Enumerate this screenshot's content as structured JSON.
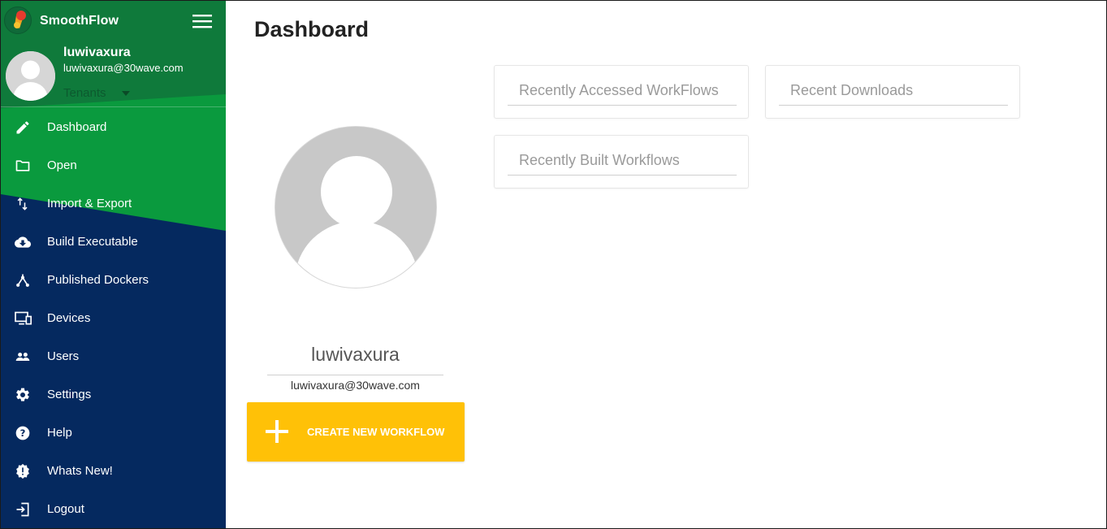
{
  "app": {
    "name": "SmoothFlow"
  },
  "user": {
    "name": "luwivaxura",
    "email": "luwivaxura@30wave.com",
    "tenants_label": "Tenants"
  },
  "nav": {
    "items": [
      {
        "label": "Dashboard",
        "icon": "pencil-icon"
      },
      {
        "label": "Open",
        "icon": "folder-icon"
      },
      {
        "label": "Import & Export",
        "icon": "import-export-icon"
      },
      {
        "label": "Build Executable",
        "icon": "cloud-download-icon"
      },
      {
        "label": "Published Dockers",
        "icon": "fork-icon"
      },
      {
        "label": "Devices",
        "icon": "devices-icon"
      },
      {
        "label": "Users",
        "icon": "users-icon"
      },
      {
        "label": "Settings",
        "icon": "gear-icon"
      },
      {
        "label": "Help",
        "icon": "help-icon"
      },
      {
        "label": "Whats New!",
        "icon": "new-badge-icon"
      },
      {
        "label": "Logout",
        "icon": "logout-icon"
      }
    ]
  },
  "main": {
    "title": "Dashboard",
    "profile": {
      "name": "luwivaxura",
      "email": "luwivaxura@30wave.com"
    },
    "create_button_label": "CREATE NEW WORKFLOW",
    "cards": [
      {
        "title": "Recently Accessed WorkFlows"
      },
      {
        "title": "Recent Downloads"
      },
      {
        "title": "Recently Built Workflows"
      }
    ]
  },
  "colors": {
    "sidebar_navy": "#05295f",
    "sidebar_green": "#0a9a3e",
    "header_green": "#0f7a3b",
    "accent_yellow": "#ffc107"
  }
}
